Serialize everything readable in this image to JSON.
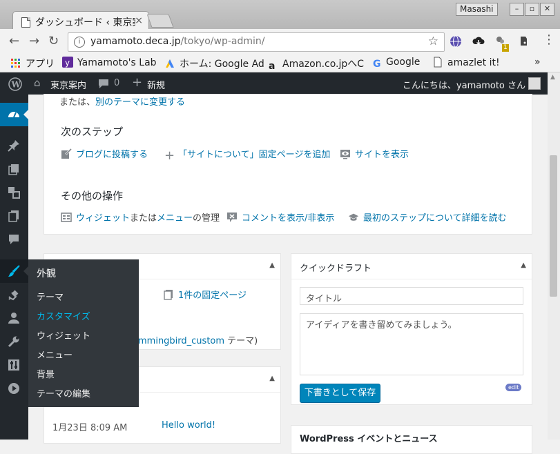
{
  "browser": {
    "tab_title": "ダッシュボード ‹ 東京案内",
    "tab_close": "×",
    "profile_name": "Masashi",
    "url_host": "yamamoto.deca.jp",
    "url_path": "/tokyo/wp-admin/",
    "extension_badge": "1",
    "bookmarks": [
      {
        "label": "アプリ",
        "icon": "apps-grid-icon"
      },
      {
        "label": "Yamamoto's Lab",
        "icon": "yahoo-icon"
      },
      {
        "label": "ホーム: Google Ad",
        "icon": "google-ads-icon"
      },
      {
        "label": "Amazon.co.jpへC",
        "icon": "amazon-icon"
      },
      {
        "label": "Google",
        "icon": "google-icon"
      },
      {
        "label": "amazlet it!",
        "icon": "page-icon"
      }
    ],
    "bookmarks_overflow": "»"
  },
  "adminbar": {
    "site_name": "東京案内",
    "comments_count": "0",
    "new_label": "新規",
    "greeting": "こんにちは、yamamoto さん"
  },
  "welcome": {
    "change_theme_prefix": "または、",
    "change_theme_link": "別のテーマに変更する",
    "next_steps_title": "次のステップ",
    "next_steps": [
      {
        "label": "ブログに投稿する",
        "icon": "edit-icon"
      },
      {
        "label": "「サイトについて」固定ページを追加",
        "icon": "plus-icon"
      },
      {
        "label": "サイトを表示",
        "icon": "view-site-icon"
      }
    ],
    "more_actions_title": "その他の操作",
    "widgets_link": "ウィジェット",
    "widgets_mid": "または",
    "menus_link": "メニュー",
    "widgets_suffix": "の管理",
    "comments_toggle": "コメントを表示/非表示",
    "learn_more": "最初のステップについて詳細を読む"
  },
  "at_a_glance": {
    "pages_count": "1件の固定ページ",
    "theme_name_partial": "mmingbird_custom",
    "theme_suffix": " テーマ)"
  },
  "activity": {
    "date": "1月23日 8:09 AM",
    "post_title": "Hello world!"
  },
  "quick_draft": {
    "title": "クイックドラフト",
    "title_placeholder": "タイトル",
    "content_placeholder": "アイディアを書き留めてみましょう。",
    "save_button": "下書きとして保存",
    "edit_badge": "edit"
  },
  "wp_news": {
    "title_partial": "WordPress イベントとニュース"
  },
  "appearance_flyout": {
    "heading": "外観",
    "items": [
      "テーマ",
      "カスタマイズ",
      "ウィジェット",
      "メニュー",
      "背景",
      "テーマの編集"
    ],
    "current_index": 1
  },
  "colors": {
    "admin_dark": "#23282d",
    "wp_blue": "#0073aa",
    "highlight": "#00b9eb"
  }
}
